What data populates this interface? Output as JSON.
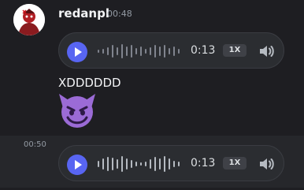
{
  "message1": {
    "username": "redanpl",
    "timestamp": "00:48",
    "voice": {
      "duration": "0:13",
      "speed": "1X"
    },
    "text": "XDDDDDD",
    "emoji_icon": "smiling-imp-emoji-icon"
  },
  "message2": {
    "timestamp": "00:50",
    "voice": {
      "duration": "0:13",
      "speed": "1X"
    }
  },
  "colors": {
    "background": "#1e1e22",
    "hover_row": "#26272b",
    "voice_bg": "#2b2d31",
    "accent_blurple": "#5865f2",
    "emoji_purple": "#9b6bd6"
  }
}
